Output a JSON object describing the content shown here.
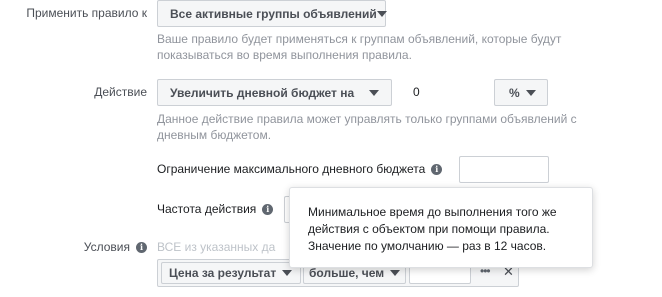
{
  "rule_target": {
    "label": "Применить правило к",
    "dropdown_value": "Все активные группы объявлений",
    "help_line1": "Ваше правило будет применяться к группам объявлений, которые будут",
    "help_line2": "показываться во время выполнения правила."
  },
  "action": {
    "label": "Действие",
    "dropdown_value": "Увеличить дневной бюджет на",
    "amount": "0",
    "unit": "%",
    "help_line1": "Данное действие правила может управлять только группами объявлений с",
    "help_line2": "дневным бюджетом.",
    "limit_label": "Ограничение максимального дневного бюджета",
    "frequency_label": "Частота действия"
  },
  "conditions": {
    "label": "Условия",
    "all_criteria_text": "ВСЕ из указанных да",
    "metric": "Цена за результат",
    "operator": "больше, чем",
    "more_menu": "•••",
    "remove": "✕"
  },
  "tooltip": {
    "line1": "Минимальное время до выполнения того же",
    "line2": "действия с объектом при помощи правила.",
    "line3": "Значение по умолчанию — раз в 12 часов."
  },
  "icons": {
    "info": "info-icon",
    "caret": "caret-down-icon",
    "more": "more-icon",
    "close": "close-icon"
  }
}
